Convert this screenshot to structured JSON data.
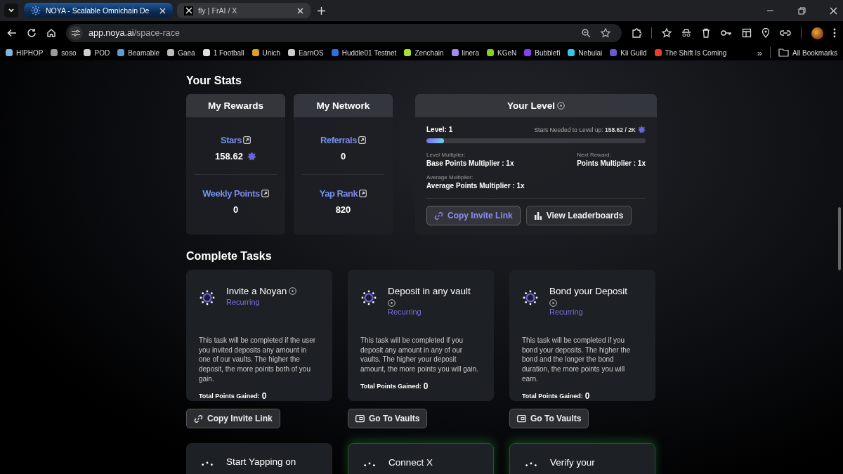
{
  "browser": {
    "tabs": [
      {
        "title": "NOYA - Scalable Omnichain De",
        "selected": true,
        "kind": "noya"
      },
      {
        "title": "fly | 𝔽rAI / X",
        "selected": false,
        "kind": "x"
      }
    ],
    "url_host": "app.noya.ai",
    "url_path": "/space-race",
    "bookmarks": [
      {
        "label": "HIPHOP",
        "color": "#7fb3e0"
      },
      {
        "label": "soso",
        "color": "#9a9a9a"
      },
      {
        "label": "POD",
        "color": "#d0d0d0"
      },
      {
        "label": "Beamable",
        "color": "#5a9bd8"
      },
      {
        "label": "Gaea",
        "color": "#bbbbbb"
      },
      {
        "label": "1 Football",
        "color": "#e0e0e0"
      },
      {
        "label": "Unich",
        "color": "#e0a020"
      },
      {
        "label": "EarnOS",
        "color": "#cccccc"
      },
      {
        "label": "Huddle01 Testnet",
        "color": "#2f6fe4"
      },
      {
        "label": "Zenchain",
        "color": "#a6e22e"
      },
      {
        "label": "linera",
        "color": "#a58cf0"
      },
      {
        "label": "KGeN",
        "color": "#7ed321"
      },
      {
        "label": "Bubblefi",
        "color": "#8a3ff0"
      },
      {
        "label": "Nebulai",
        "color": "#30c8e8"
      },
      {
        "label": "Kii Guild",
        "color": "#6a5acd"
      },
      {
        "label": "The Shift Is Coming",
        "color": "#e8401c"
      }
    ],
    "bookmarks_more": "»",
    "all_bookmarks": "All Bookmarks"
  },
  "stats": {
    "title": "Your Stats",
    "cards": [
      {
        "title": "My Rewards",
        "items": [
          {
            "label": "Stars",
            "value": "158.62",
            "star": true
          },
          {
            "label": "Weekly Points",
            "value": "0",
            "star": false
          }
        ]
      },
      {
        "title": "My Network",
        "items": [
          {
            "label": "Referrals",
            "value": "0",
            "star": false
          },
          {
            "label": "Yap Rank",
            "value": "820",
            "star": false
          }
        ]
      }
    ],
    "level": {
      "title": "Your Level",
      "level_label": "Level: 1",
      "needed": "Stars Needed to Level up: **158.62 / 2K**",
      "level": 0.08,
      "multipliers": [
        {
          "caption": "Level Multiplier:",
          "value": "Base Points Multiplier : 1x"
        },
        {
          "caption": "Next Reward:",
          "value": "Points Multiplier : 1x"
        },
        {
          "caption": "Average Multiplier:",
          "value": "Average Points Multiplier : 1x"
        }
      ],
      "buttons": [
        {
          "label": "Copy Invite Link",
          "kind": "link"
        },
        {
          "label": "View Leaderboards",
          "kind": "chart"
        }
      ]
    }
  },
  "tasks": {
    "title": "Complete Tasks",
    "items": [
      {
        "title": "Invite a Noyan",
        "tag": "Recurring",
        "text": "This task will be completed if the user you invited deposits any amount in one of our vaults. The higher the deposit, the more points both of you gain.",
        "total_label": "Total Points Gained:",
        "total": "0",
        "button": {
          "label": "Copy Invite Link",
          "kind": "link"
        },
        "highlighted": false
      },
      {
        "title": "Deposit in any vault",
        "tag": "Recurring",
        "text": "This task will be completed if you deposit any amount in any of our vaults. The higher your deposit amount, the more points you will gain.",
        "total_label": "Total Points Gained:",
        "total": "0",
        "button": {
          "label": "Go To Vaults",
          "kind": "vault"
        },
        "highlighted": false
      },
      {
        "title": "Bond your Deposit",
        "tag": "Recurring",
        "text": "This task will be completed if you bond your deposits. The higher the bond and the longer the bond duration, the more points you will earn.",
        "total_label": "Total Points Gained:",
        "total": "0",
        "button": {
          "label": "Go To Vaults",
          "kind": "vault"
        },
        "highlighted": false
      },
      {
        "title": "Start Yapping on",
        "highlighted": false
      },
      {
        "title": "Connect X",
        "highlighted": true
      },
      {
        "title": "Verify your",
        "highlighted": true
      }
    ]
  }
}
